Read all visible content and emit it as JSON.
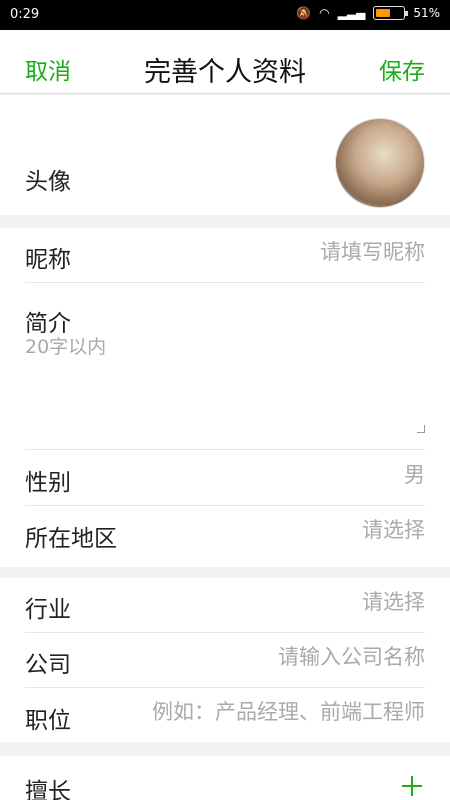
{
  "status_bar": {
    "time": "0:29",
    "battery": "51%"
  },
  "nav": {
    "cancel": "取消",
    "title": "完善个人资料",
    "save": "保存"
  },
  "profile": {
    "avatar_label": "头像"
  },
  "basic": {
    "nickname_label": "昵称",
    "nickname_placeholder": "请填写昵称",
    "intro_label": "简介",
    "intro_placeholder": "20字以内",
    "gender_label": "性别",
    "gender_value": "男",
    "region_label": "所在地区",
    "region_value": "请选择"
  },
  "work": {
    "industry_label": "行业",
    "industry_value": "请选择",
    "company_label": "公司",
    "company_placeholder": "请输入公司名称",
    "position_label": "职位",
    "position_placeholder": "例如：产品经理、前端工程师"
  },
  "skills": {
    "label": "擅长"
  },
  "colors": {
    "accent": "#1aad19",
    "placeholder": "#aaaaaa"
  }
}
